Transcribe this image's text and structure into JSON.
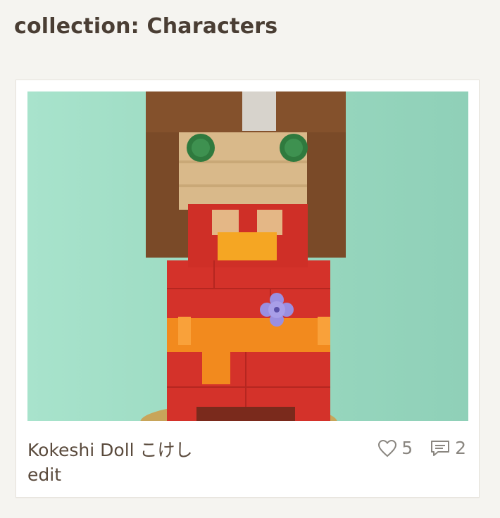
{
  "page": {
    "title": "collection: Characters"
  },
  "card": {
    "image_alt": "Kokeshi Doll こけし",
    "title": "Kokeshi Doll こけし",
    "edit_label": "edit",
    "likes": "5",
    "comments": "2",
    "like_icon": "heart-icon",
    "comment_icon": "comment-icon"
  },
  "colors": {
    "background": "#f5f4f0",
    "title_text": "#4a3e34",
    "body_text": "#5a4a3c",
    "stat_text": "#8a8680",
    "photo_bg": "#9fdcc3"
  }
}
